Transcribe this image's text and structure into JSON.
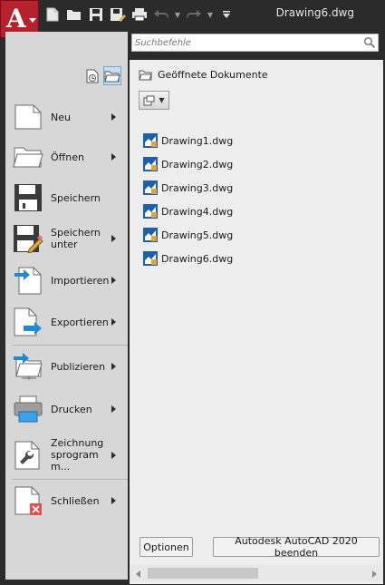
{
  "window": {
    "title": "Drawing6.dwg"
  },
  "app_button": {
    "letter": "A",
    "icon": "autocad-logo-icon"
  },
  "quick_access": [
    {
      "icon": "new-doc-icon"
    },
    {
      "icon": "open-folder-icon"
    },
    {
      "icon": "save-icon"
    },
    {
      "icon": "save-as-icon"
    },
    {
      "icon": "print-icon"
    },
    {
      "icon": "undo-icon"
    },
    {
      "icon": "redo-icon"
    },
    {
      "icon": "customize-qat-icon"
    }
  ],
  "search": {
    "placeholder": "Suchbefehle",
    "value": ""
  },
  "left_menu": [
    {
      "label": "Neu",
      "icon": "new-doc-icon",
      "has_submenu": true
    },
    {
      "label": "Öffnen",
      "icon": "open-folder-icon",
      "has_submenu": true
    },
    {
      "label": "Speichern",
      "icon": "save-icon",
      "has_submenu": false
    },
    {
      "label": "Speichern unter",
      "icon": "save-as-icon",
      "has_submenu": true
    },
    {
      "label": "Importieren",
      "icon": "import-icon",
      "has_submenu": true
    },
    {
      "label": "Exportieren",
      "icon": "export-icon",
      "has_submenu": true
    },
    {
      "label": "Publizieren",
      "icon": "publish-icon",
      "has_submenu": true
    },
    {
      "label": "Drucken",
      "icon": "print-icon",
      "has_submenu": true
    },
    {
      "label": "Zeichnungsprogramm...",
      "icon": "wrench-icon",
      "has_submenu": true
    },
    {
      "label": "Schließen",
      "icon": "close-doc-icon",
      "has_submenu": true
    }
  ],
  "right_panel": {
    "header": "Geöffnete Dokumente",
    "documents": [
      "Drawing1.dwg",
      "Drawing2.dwg",
      "Drawing3.dwg",
      "Drawing4.dwg",
      "Drawing5.dwg",
      "Drawing6.dwg"
    ]
  },
  "buttons": {
    "options": "Optionen",
    "exit": "Autodesk AutoCAD 2020 beenden"
  },
  "colors": {
    "accent_red": "#b6212d",
    "arrow_blue": "#1f8ad6",
    "close_red": "#e44d4d"
  }
}
